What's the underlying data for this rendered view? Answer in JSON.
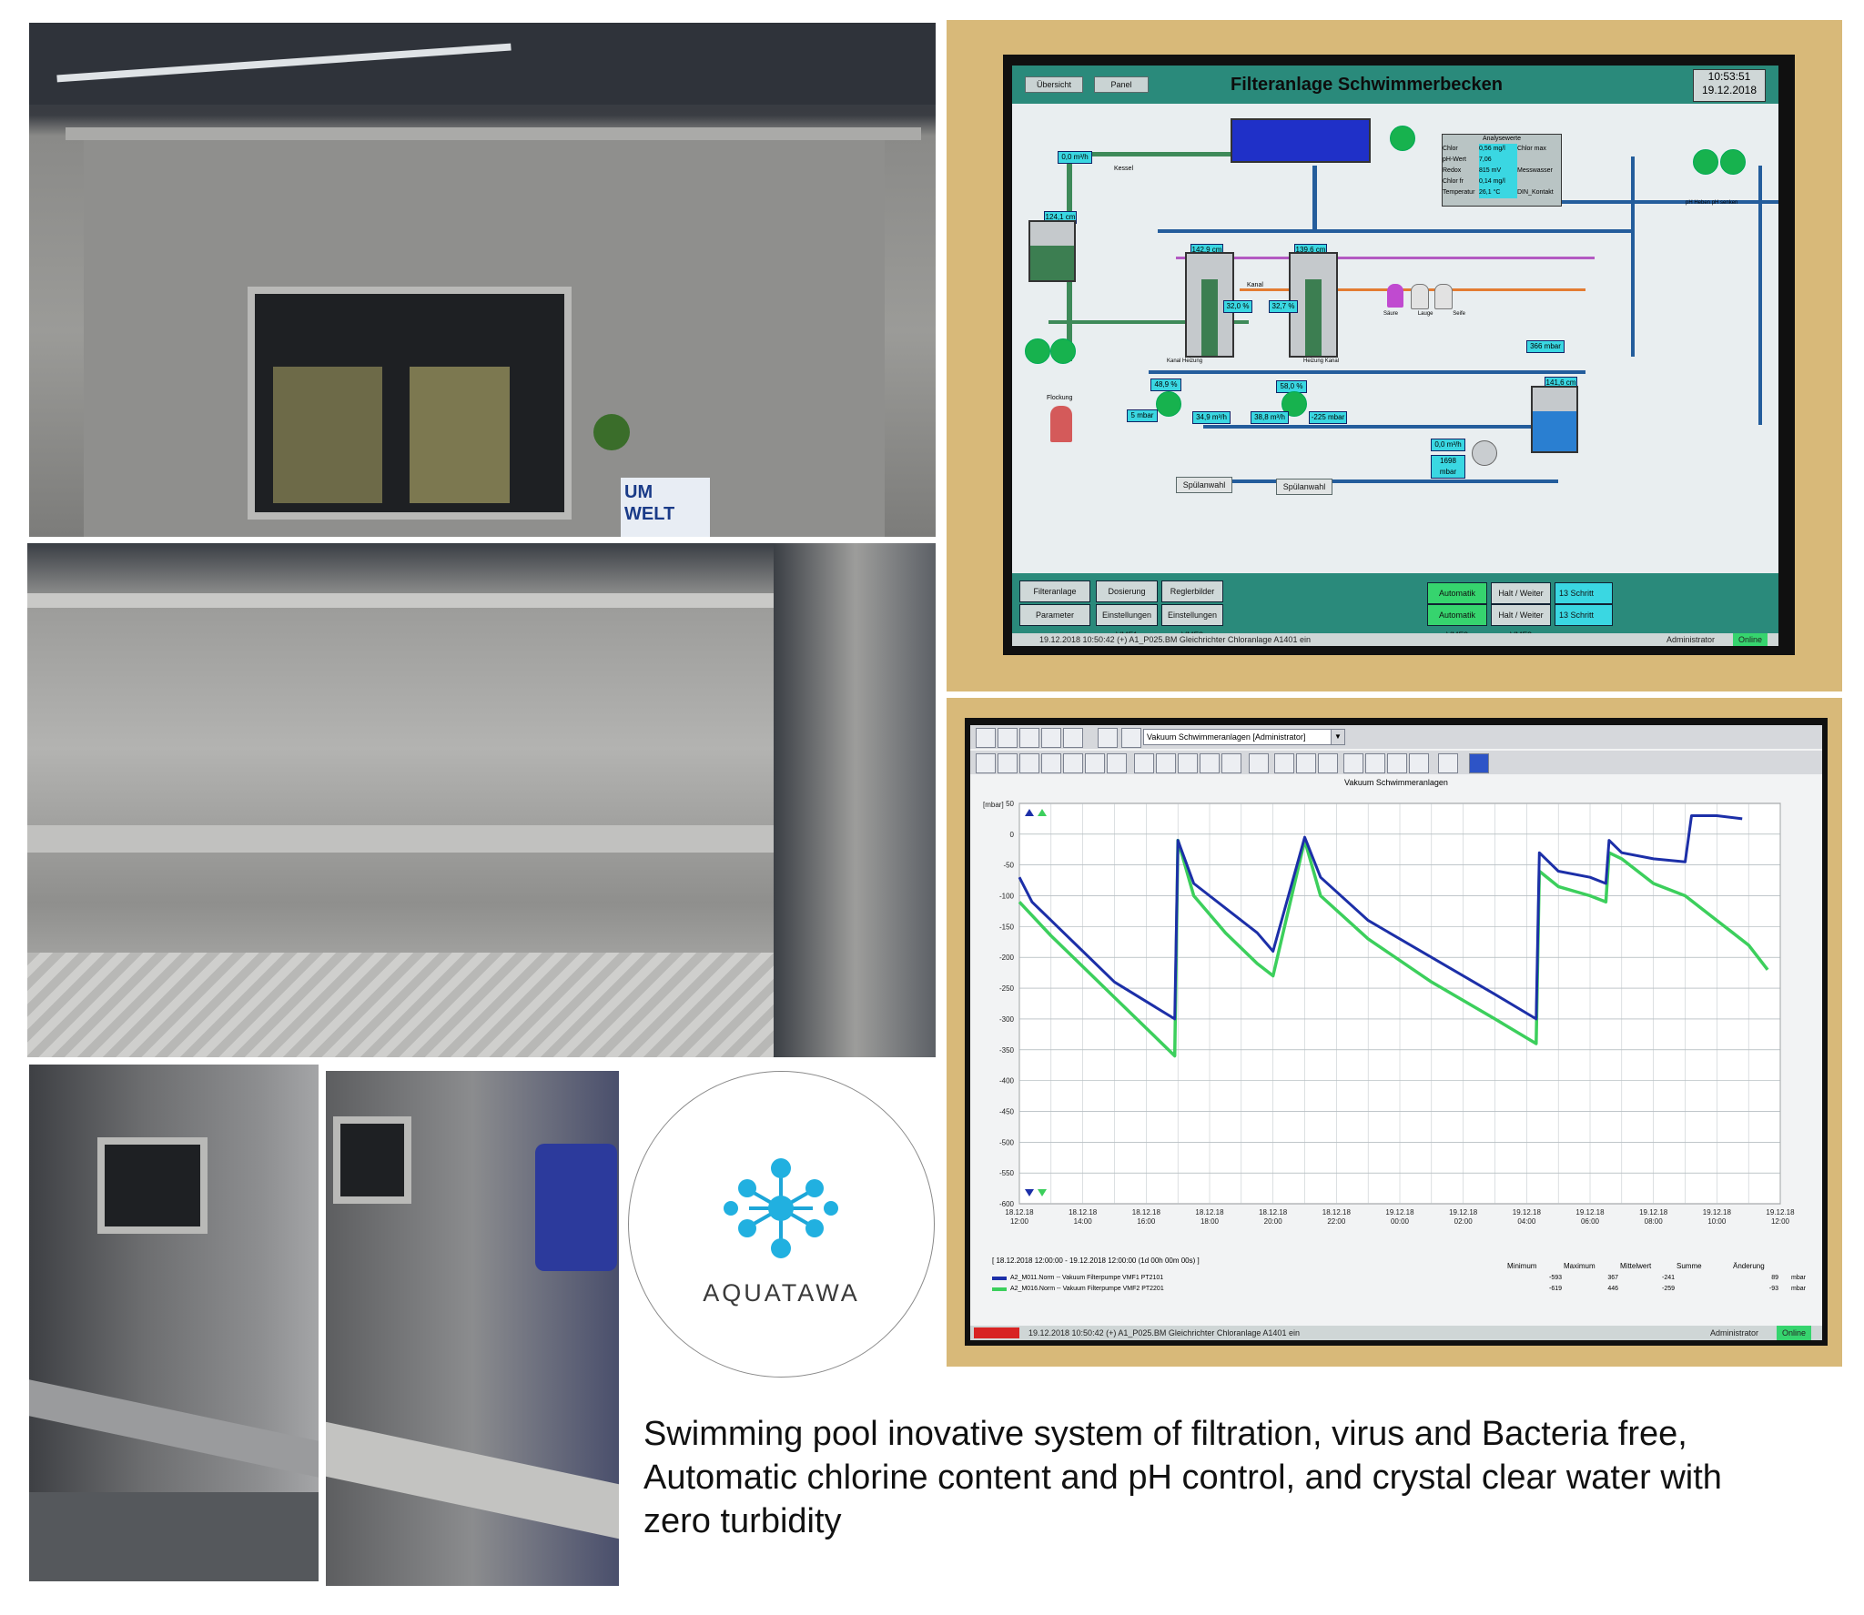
{
  "photos": {
    "top_sticker": "UM WELT"
  },
  "hmi": {
    "buttons_top": [
      "Übersicht",
      "Panel"
    ],
    "title": "Filteranlage Schwimmerbecken",
    "time": "10:53:51",
    "date": "19.12.2018",
    "analysis": {
      "header": "Analysewerte",
      "rows": [
        {
          "label": "Chlor",
          "value": "0,56 mg/l",
          "extra": "Chlor max"
        },
        {
          "label": "pH-Wert",
          "value": "7,06",
          "extra": ""
        },
        {
          "label": "Redox",
          "value": "815 mV",
          "extra": "Messwasser"
        },
        {
          "label": "Chlor fr",
          "value": "0,14 mg/l",
          "extra": ""
        },
        {
          "label": "Temperatur",
          "value": "26,1 °C",
          "extra": "DIN_Kontakt"
        }
      ]
    },
    "labels": {
      "kessel": "Kessel",
      "kanal": "Kanal",
      "flockung": "Flockung",
      "heizung": "Heizung",
      "saure": "Säure",
      "lauge": "Lauge",
      "seife": "Seife",
      "ph_heben": "pH Heben",
      "ph_senken": "pH senken"
    },
    "tags": {
      "flow1": "0,0 m³/h",
      "level1": "124,1 cm",
      "tank1": "142,9 cm",
      "tank2": "139,6 cm",
      "pct1": "32,0 %",
      "pct2": "32,7 %",
      "pct3": "48,9 %",
      "pct4": "58,0 %",
      "p1": "5 mbar",
      "f1": "34,9 m³/h",
      "f2": "38,8 m³/h",
      "p2": "-225 mbar",
      "p3": "366 mbar",
      "level2": "141,6 cm",
      "flow2": "0,0 m³/h",
      "p4": "1698 mbar"
    },
    "spuelwahl": [
      "Spülanwahl",
      "Spülanwahl"
    ],
    "bottom": {
      "left": [
        "Filteranlage",
        "Parameter",
        "Dosierung",
        "Einstellungen VMF1",
        "Reglerbilder",
        "Einstellungen VMF2"
      ],
      "auto": [
        "Automatik VMF1",
        "Automatik VMF2"
      ],
      "halt": [
        "Halt / Weiter VMF1",
        "Halt / Weiter VMF2"
      ],
      "schritt": [
        "13 Schritt",
        "13 Schritt"
      ]
    },
    "status": {
      "text": "19.12.2018 10:50:42   (+)  A1_P025.BM  Gleichrichter Chloranlage  A1401  ein",
      "user": "Administrator",
      "state": "Online"
    }
  },
  "trend": {
    "dropdown": "Vakuum Schwimmeranlagen  [Administrator]",
    "chart_title": "Vakuum Schwimmeranlagen",
    "unit": "[mbar]",
    "range": "[ 18.12.2018 12:00:00  -  19.12.2018 12:00:00  (1d 00h 00m 00s) ]",
    "headers": [
      "Minimum",
      "Maximum",
      "Mittelwert",
      "Summe",
      "Änderung"
    ],
    "series": [
      {
        "name": "A2_M011.Norm  --  Vakuum Filterpumpe VMF1  PT2101",
        "min": "-593",
        "max": "367",
        "mean": "-241",
        "sum": "",
        "change": "89",
        "unit": "mbar",
        "color": "#1c2fa8"
      },
      {
        "name": "A2_M016.Norm  --  Vakuum Filterpumpe VMF2  PT2201",
        "min": "-619",
        "max": "446",
        "mean": "-259",
        "sum": "",
        "change": "-93",
        "unit": "mbar",
        "color": "#3ccf5c"
      }
    ],
    "status": "19.12.2018 10:50:42   (+)  A1_P025.BM  Gleichrichter Chloranlage  A1401  ein",
    "user": "Administrator",
    "state": "Online"
  },
  "chart_data": {
    "type": "line",
    "title": "Vakuum Schwimmeranlagen",
    "ylabel": "[mbar]",
    "ylim": [
      -600,
      50
    ],
    "yticks": [
      50,
      0,
      -50,
      -100,
      -150,
      -200,
      -250,
      -300,
      -350,
      -400,
      -450,
      -500,
      -550,
      -600
    ],
    "x": [
      "18.12.18 12:00",
      "18.12.18 14:00",
      "18.12.18 16:00",
      "18.12.18 18:00",
      "18.12.18 20:00",
      "18.12.18 22:00",
      "19.12.18 00:00",
      "19.12.18 02:00",
      "19.12.18 04:00",
      "19.12.18 06:00",
      "19.12.18 08:00",
      "19.12.18 10:00",
      "19.12.18 12:00"
    ],
    "series": [
      {
        "name": "A2_M011.Norm  --  Vakuum Filterpumpe VMF1  PT2101",
        "points": [
          [
            0,
            -70
          ],
          [
            0.4,
            -110
          ],
          [
            1,
            -140
          ],
          [
            2,
            -190
          ],
          [
            3,
            -240
          ],
          [
            4.9,
            -300
          ],
          [
            5,
            -10
          ],
          [
            5.5,
            -80
          ],
          [
            6.5,
            -120
          ],
          [
            7.5,
            -160
          ],
          [
            8,
            -190
          ],
          [
            9,
            -5
          ],
          [
            9.5,
            -70
          ],
          [
            11,
            -140
          ],
          [
            13,
            -200
          ],
          [
            15,
            -260
          ],
          [
            16.3,
            -300
          ],
          [
            16.4,
            -30
          ],
          [
            17,
            -60
          ],
          [
            18,
            -70
          ],
          [
            18.5,
            -80
          ],
          [
            18.6,
            -10
          ],
          [
            19,
            -30
          ],
          [
            20,
            -40
          ],
          [
            21,
            -45
          ],
          [
            21.2,
            30
          ],
          [
            22,
            30
          ],
          [
            22.8,
            25
          ]
        ]
      },
      {
        "name": "A2_M016.Norm  --  Vakuum Filterpumpe VMF2  PT2201",
        "points": [
          [
            0,
            -110
          ],
          [
            1,
            -165
          ],
          [
            2,
            -215
          ],
          [
            3,
            -265
          ],
          [
            4.9,
            -360
          ],
          [
            5,
            -10
          ],
          [
            5.5,
            -100
          ],
          [
            6.5,
            -160
          ],
          [
            7.5,
            -210
          ],
          [
            8,
            -230
          ],
          [
            9,
            -10
          ],
          [
            9.5,
            -100
          ],
          [
            11,
            -170
          ],
          [
            13,
            -240
          ],
          [
            15,
            -300
          ],
          [
            16.3,
            -340
          ],
          [
            16.4,
            -60
          ],
          [
            17,
            -85
          ],
          [
            18,
            -100
          ],
          [
            18.5,
            -110
          ],
          [
            18.6,
            -30
          ],
          [
            19,
            -40
          ],
          [
            20,
            -80
          ],
          [
            21,
            -100
          ],
          [
            22,
            -140
          ],
          [
            23,
            -180
          ],
          [
            23.6,
            -220
          ]
        ]
      }
    ]
  },
  "logo": {
    "text": "AQUATAWA"
  },
  "caption": {
    "line1": "Swimming pool inovative system of filtration, virus and Bacteria free,",
    "line2": "Automatic chlorine content and pH control, and crystal clear water with",
    "line3": "zero turbidity"
  }
}
